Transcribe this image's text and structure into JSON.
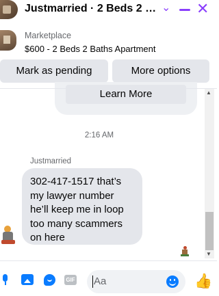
{
  "header": {
    "title": "Justmarried · 2 Beds 2 Bat...",
    "chevron_glyph": "⌄",
    "close_glyph": "✕"
  },
  "marketplace": {
    "label": "Marketplace",
    "listing": "$600 - 2 Beds 2 Baths Apartment"
  },
  "actions": {
    "mark_pending": "Mark as pending",
    "more_options": "More options"
  },
  "chat": {
    "learn_more": "Learn More",
    "timestamp": "2:16 AM",
    "sender_name": "Justmarried",
    "message": "302-417-1517 that’s\nmy lawyer number\nhe’ll keep me in loop\ntoo many scammers\non here"
  },
  "composer": {
    "placeholder": "Aa",
    "gif_label": "GIF",
    "like_glyph": "👍"
  },
  "scrollbar": {
    "up_glyph": "▲",
    "down_glyph": "▼"
  },
  "colors": {
    "accent": "#8a3ffc",
    "messenger_blue": "#0a7cff",
    "bubble_gray": "#e4e6eb"
  },
  "icons": [
    "chevron-down-icon",
    "minimize-icon",
    "close-icon",
    "microphone-icon",
    "photo-icon",
    "sticker-icon",
    "gif-icon",
    "emoji-icon",
    "thumbs-up-icon"
  ]
}
